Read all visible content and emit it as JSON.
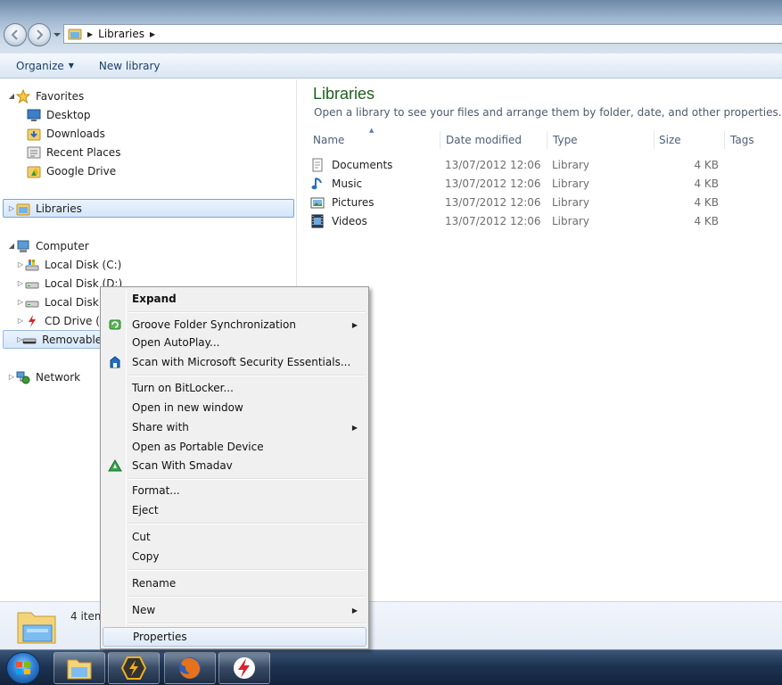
{
  "address": {
    "crumb": "Libraries"
  },
  "toolbar": {
    "organize_label": "Organize",
    "new_library_label": "New library"
  },
  "nav": {
    "favorites": "Favorites",
    "desktop": "Desktop",
    "downloads": "Downloads",
    "recent_places": "Recent Places",
    "google_drive": "Google Drive",
    "libraries": "Libraries",
    "computer": "Computer",
    "local_c": "Local Disk (C:)",
    "local_d": "Local Disk (D:)",
    "local_e": "Local Disk (",
    "cd_drive": "CD Drive (F:",
    "removable": "Removable",
    "network": "Network"
  },
  "content": {
    "title": "Libraries",
    "subtitle": "Open a library to see your files and arrange them by folder, date, and other properties.",
    "columns": {
      "name": "Name",
      "date": "Date modified",
      "type": "Type",
      "size": "Size",
      "tags": "Tags"
    },
    "rows": [
      {
        "name": "Documents",
        "date": "13/07/2012 12:06",
        "type": "Library",
        "size": "4 KB"
      },
      {
        "name": "Music",
        "date": "13/07/2012 12:06",
        "type": "Library",
        "size": "4 KB"
      },
      {
        "name": "Pictures",
        "date": "13/07/2012 12:06",
        "type": "Library",
        "size": "4 KB"
      },
      {
        "name": "Videos",
        "date": "13/07/2012 12:06",
        "type": "Library",
        "size": "4 KB"
      }
    ]
  },
  "details": {
    "count": "4 item"
  },
  "menu": {
    "expand": "Expand",
    "groove": "Groove Folder Synchronization",
    "autoplay": "Open AutoPlay...",
    "scan_mse": "Scan with Microsoft Security Essentials...",
    "bitlocker": "Turn on BitLocker...",
    "new_window": "Open in new window",
    "share_with": "Share with",
    "portable": "Open as Portable Device",
    "smadav": "Scan With Smadav",
    "format": "Format...",
    "eject": "Eject",
    "cut": "Cut",
    "copy": "Copy",
    "rename": "Rename",
    "new": "New",
    "properties": "Properties"
  },
  "colors": {
    "title_green": "#1e5e1e",
    "link_blue": "#1e3f66",
    "selection": "#d4e6fb"
  }
}
